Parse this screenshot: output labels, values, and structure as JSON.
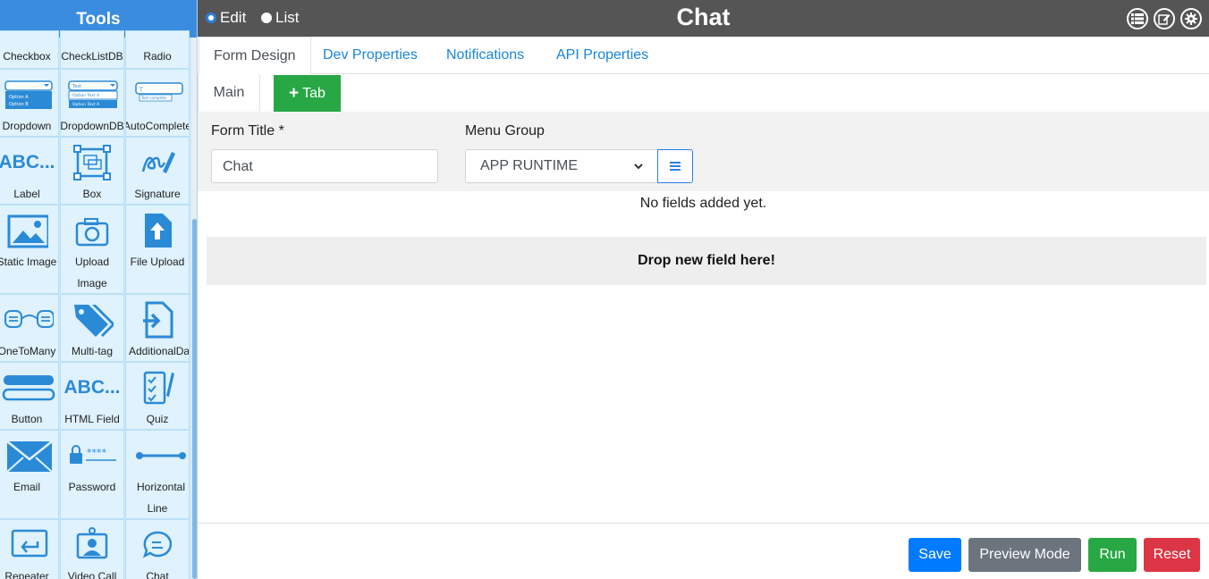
{
  "sidebar": {
    "title": "Tools",
    "tools": [
      {
        "label": "Checkbox",
        "icon": "checkbox-icon"
      },
      {
        "label": "CheckListDB",
        "icon": "checklistdb-icon"
      },
      {
        "label": "Radio",
        "icon": "radio-icon"
      },
      {
        "label": "Dropdown",
        "icon": "dropdown-icon",
        "thumb_text": [
          "Option A",
          "Option B"
        ]
      },
      {
        "label": "DropdownDB",
        "icon": "dropdowndb-icon",
        "thumb_text": [
          "Text",
          "Option Text A",
          "Option Text A"
        ]
      },
      {
        "label": "AutoComplete",
        "icon": "autocomplete-icon",
        "thumb_text": [
          "T",
          "Text complete"
        ]
      },
      {
        "label": "Label",
        "icon": "label-icon",
        "glyph": "ABC..."
      },
      {
        "label": "Box",
        "icon": "box-icon"
      },
      {
        "label": "Signature",
        "icon": "signature-icon"
      },
      {
        "label": "Static Image",
        "icon": "image-icon"
      },
      {
        "label": "Upload Image",
        "icon": "camera-icon"
      },
      {
        "label": "File Upload",
        "icon": "file-upload-icon"
      },
      {
        "label": "OneToMany",
        "icon": "one-to-many-icon"
      },
      {
        "label": "Multi-tag",
        "icon": "tags-icon"
      },
      {
        "label": "AdditionalData",
        "icon": "additional-data-icon"
      },
      {
        "label": "Button",
        "icon": "button-icon"
      },
      {
        "label": "HTML Field",
        "icon": "html-field-icon",
        "glyph": "ABC..."
      },
      {
        "label": "Quiz",
        "icon": "quiz-icon"
      },
      {
        "label": "Email",
        "icon": "email-icon"
      },
      {
        "label": "Password",
        "icon": "password-icon",
        "glyph": "****"
      },
      {
        "label": "Horizontal Line",
        "icon": "horizontal-line-icon"
      },
      {
        "label": "Repeater",
        "icon": "repeater-icon"
      },
      {
        "label": "Video Call",
        "icon": "video-call-icon"
      },
      {
        "label": "Chat",
        "icon": "chat-icon"
      }
    ]
  },
  "topbar": {
    "modes": [
      {
        "label": "Edit",
        "checked": true
      },
      {
        "label": "List",
        "checked": false
      }
    ],
    "title": "Chat",
    "icons": [
      "list-icon",
      "edit-icon",
      "settings-icon"
    ]
  },
  "tabs": [
    {
      "label": "Form Design",
      "active": true
    },
    {
      "label": "Dev Properties",
      "active": false
    },
    {
      "label": "Notifications",
      "active": false
    },
    {
      "label": "API Properties",
      "active": false
    }
  ],
  "subtabs": {
    "main": "Main",
    "add_tab": "Tab"
  },
  "form": {
    "title_label": "Form Title *",
    "title_value": "Chat",
    "menu_group_label": "Menu Group",
    "menu_group_value": "APP RUNTIME"
  },
  "empty_message": "No fields added yet.",
  "drop_zone": "Drop new field here!",
  "footer": {
    "save": "Save",
    "preview": "Preview Mode",
    "run": "Run",
    "reset": "Reset"
  },
  "colors": {
    "accent": "#2d7fe0",
    "sidebar_header": "#3a8dde",
    "topbar": "#555555",
    "save": "#007bff",
    "preview": "#6c757d",
    "run": "#28a745",
    "reset": "#dc3545"
  }
}
